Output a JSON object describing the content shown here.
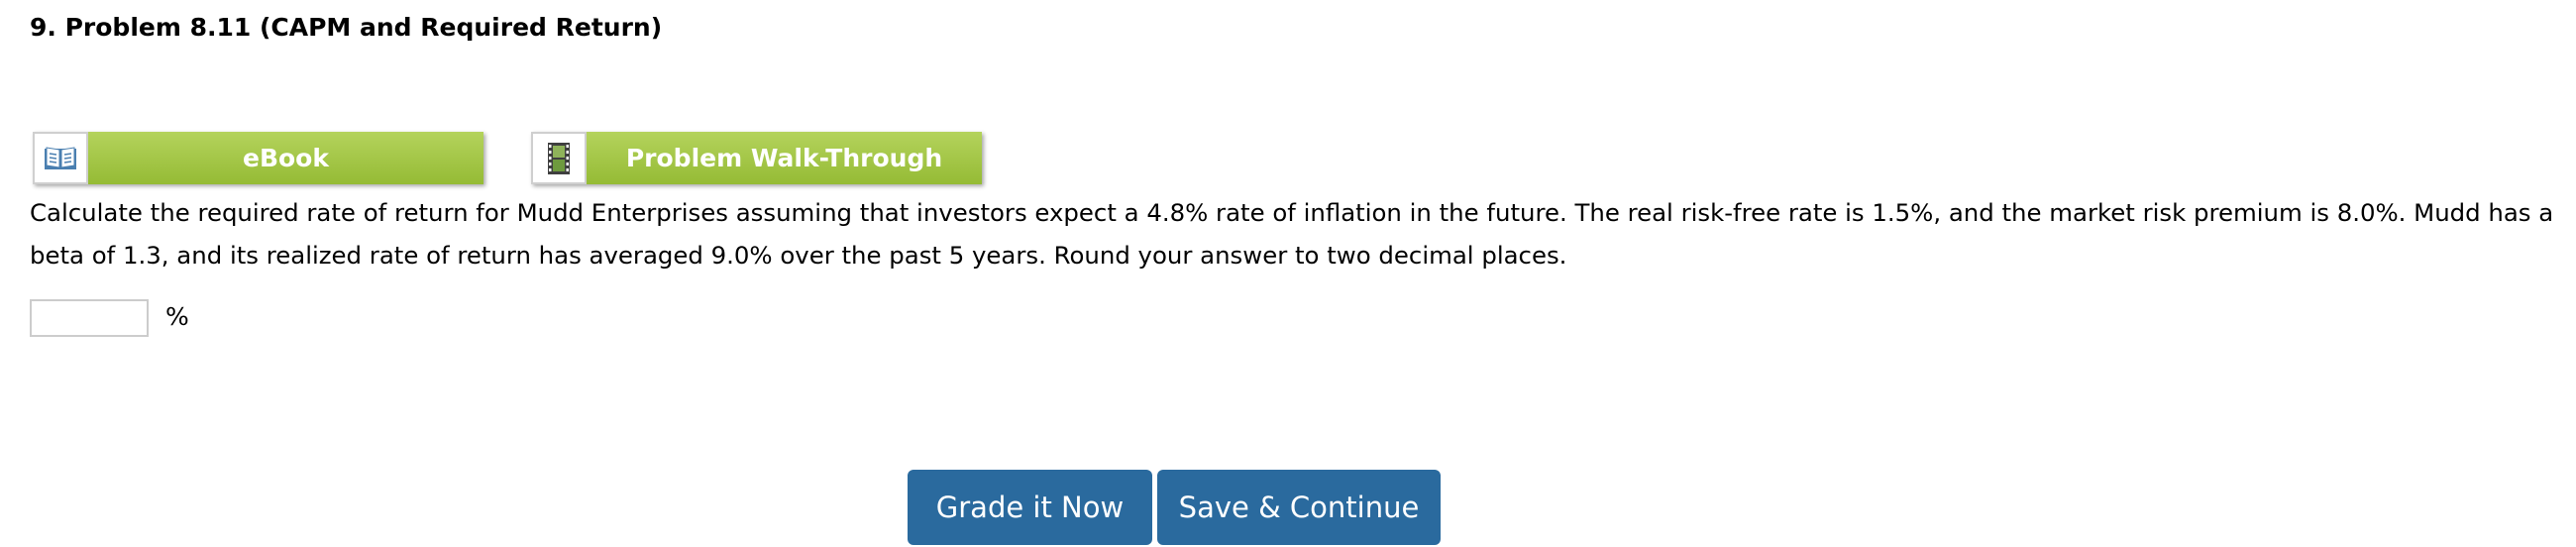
{
  "problem": {
    "title": "9.  Problem 8.11 (CAPM and Required Return)"
  },
  "resources": {
    "ebook": {
      "label": "eBook",
      "icon": "book-icon",
      "accent": "#a6c84a"
    },
    "walkthrough": {
      "label": "Problem Walk-Through",
      "icon": "film-icon",
      "accent": "#a6c84a"
    }
  },
  "question": {
    "line1": "Calculate the required rate of return for Mudd Enterprises assuming that investors expect a 4.8% rate of inflation in the future. The real risk-free rate is 1.5%, and the market risk premium is 8.0%. Mudd has a",
    "line2": "beta of 1.3, and its realized rate of return has averaged 9.0% over the past 5 years. Round your answer to two decimal places."
  },
  "answer": {
    "value": "",
    "placeholder": "",
    "unit": "%"
  },
  "actions": {
    "grade_label": "Grade it Now",
    "save_label": "Save & Continue",
    "button_color": "#2a6a9e"
  }
}
